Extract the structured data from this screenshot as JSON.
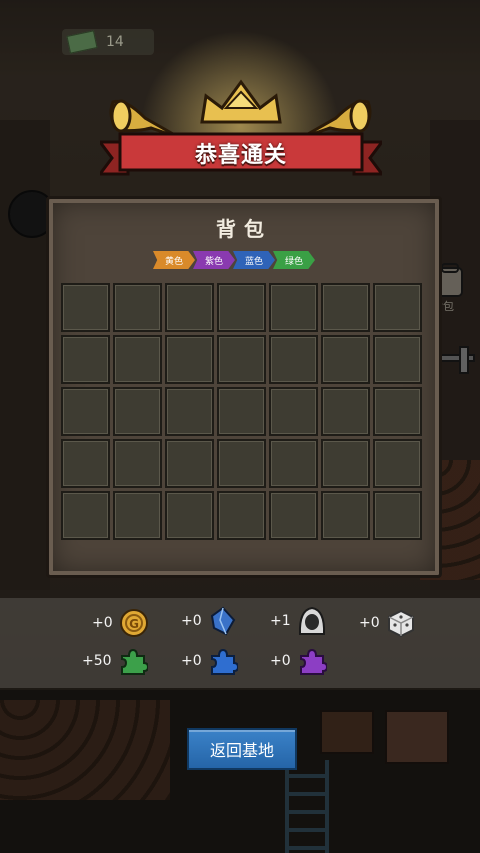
{
  "hud": {
    "cash_value": "14",
    "cash_icon": "cash-icon"
  },
  "header": {
    "title": "恭喜通关",
    "accent_color": "#c9393a",
    "gold_color": "#e0b64a"
  },
  "bag": {
    "title": "背包",
    "tags": [
      {
        "label": "黄色",
        "color": "#d98a2a"
      },
      {
        "label": "紫色",
        "color": "#8a3ab0"
      },
      {
        "label": "蓝色",
        "color": "#2f63b8"
      },
      {
        "label": "绿色",
        "color": "#3aa045"
      }
    ],
    "rows": 5,
    "cols": 7
  },
  "rewards": [
    {
      "value": "+0",
      "icon": "gold-coin-icon"
    },
    {
      "value": "+0",
      "icon": "blue-crystal-icon"
    },
    {
      "value": "+1",
      "icon": "hooded-character-icon"
    },
    {
      "value": "+0",
      "icon": "white-dice-icon"
    },
    {
      "value": "+50",
      "icon": "green-puzzle-icon"
    },
    {
      "value": "+0",
      "icon": "blue-puzzle-icon"
    },
    {
      "value": "+0",
      "icon": "purple-puzzle-icon"
    }
  ],
  "actions": {
    "back_label": "返回基地"
  },
  "side": {
    "pack_label": "背包"
  }
}
